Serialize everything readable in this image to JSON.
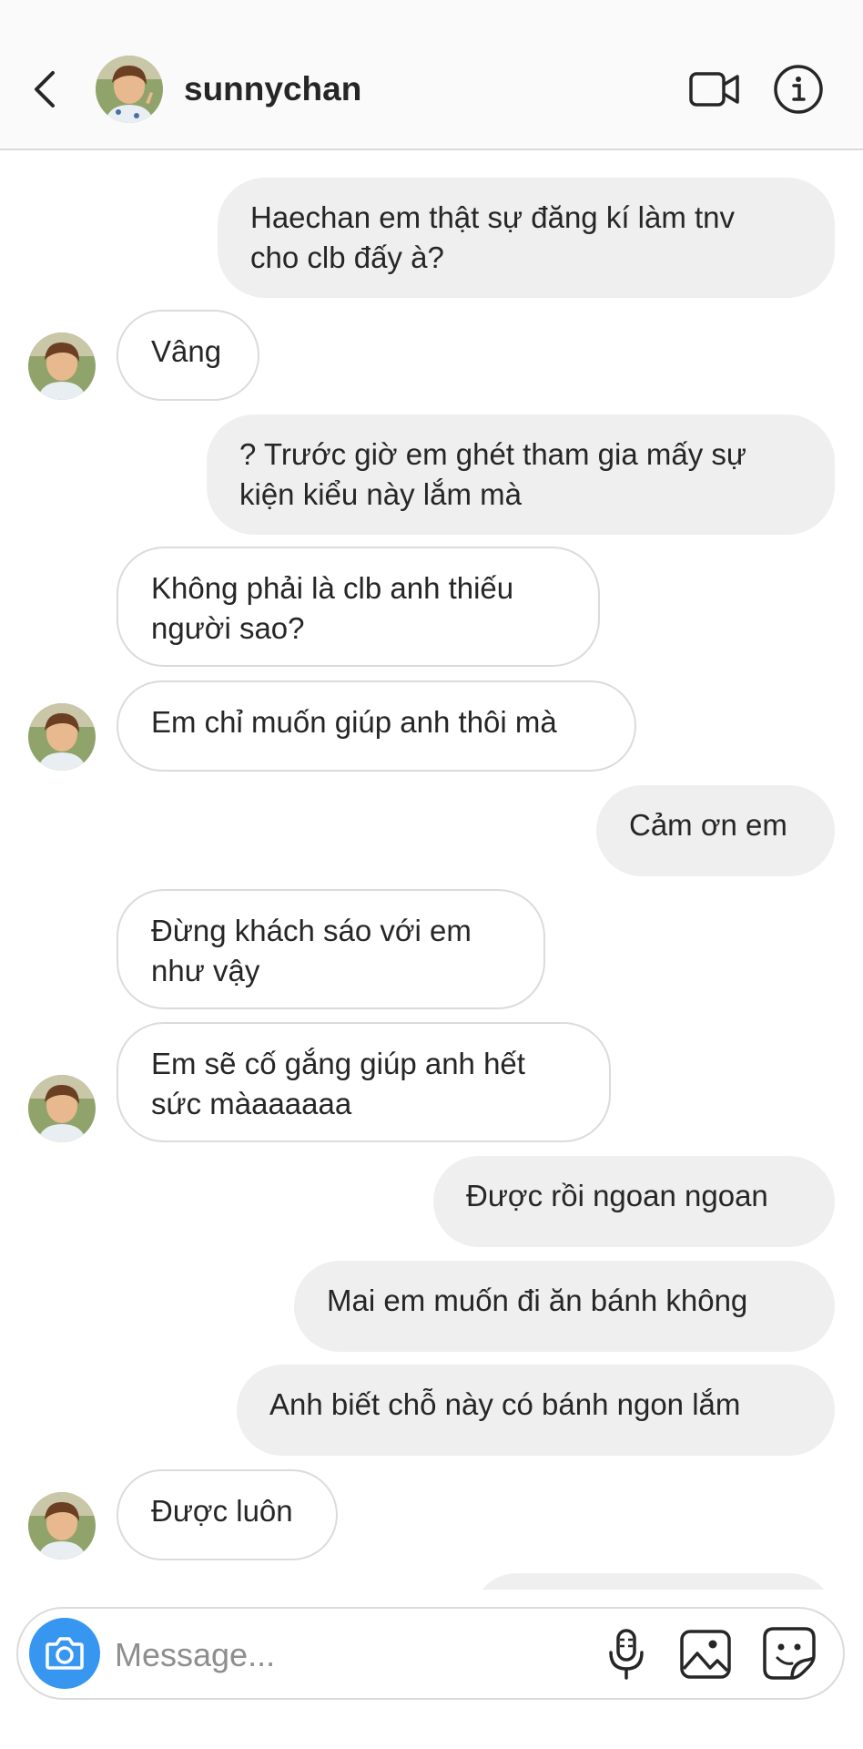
{
  "header": {
    "username": "sunnychan"
  },
  "messages": [
    {
      "side": "out",
      "text": "Haechan em thật sự đăng kí làm tnv\ncho clb đấy à?"
    },
    {
      "side": "in",
      "text": "Vâng"
    },
    {
      "side": "out",
      "text": "? Trước giờ em ghét tham gia mấy sự\nkiện kiểu này lắm mà"
    },
    {
      "side": "in",
      "text": "Không phải là clb anh thiếu\nngười sao?"
    },
    {
      "side": "in",
      "text": "Em chỉ muốn giúp anh thôi mà"
    },
    {
      "side": "out",
      "text": "Cảm ơn em"
    },
    {
      "side": "in",
      "text": "Đừng khách sáo với em\nnhư vậy"
    },
    {
      "side": "in",
      "text": "Em sẽ cố gắng giúp anh hết\nsức màaaaaaa"
    },
    {
      "side": "out",
      "text": "Được rồi ngoan ngoan"
    },
    {
      "side": "out",
      "text": "Mai em muốn đi ăn bánh không"
    },
    {
      "side": "out",
      "text": "Anh biết chỗ này có bánh ngon lắm"
    },
    {
      "side": "in",
      "text": "Được luôn"
    }
  ],
  "composer": {
    "placeholder": "Message..."
  },
  "icons": {
    "back": "chevron-left-icon",
    "video": "video-camera-icon",
    "info": "info-icon",
    "camera": "camera-icon",
    "mic": "microphone-icon",
    "gallery": "image-gallery-icon",
    "sticker": "sticker-icon"
  },
  "colors": {
    "outgoing_bubble": "#efefef",
    "incoming_border": "#dbdbdb",
    "camera_button": "#3797f0",
    "header_bg": "#fafafa"
  }
}
